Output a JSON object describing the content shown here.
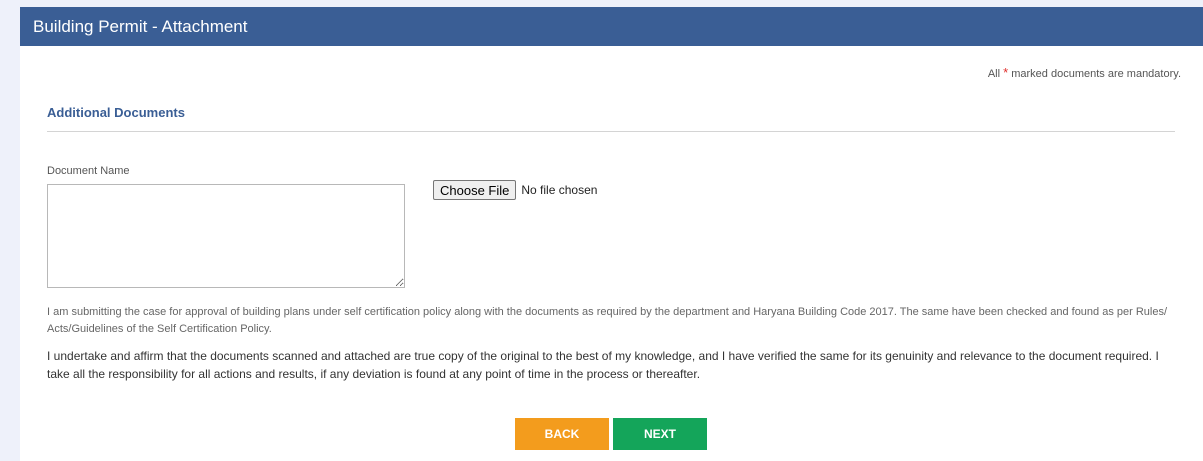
{
  "panel": {
    "title": "Building Permit - Attachment"
  },
  "mandatory_note": {
    "prefix": "All",
    "star": "*",
    "suffix": "marked documents are mandatory."
  },
  "section": {
    "title": "Additional Documents"
  },
  "document": {
    "label": "Document Name",
    "value": "",
    "choose_file_label": "Choose File",
    "file_status": "No file chosen"
  },
  "declarations": [
    "I am submitting the case for approval of building plans under self certification policy along with the documents as required by the department and Haryana Building Code 2017. The same have been checked and found as per Rules/ Acts/Guidelines of the Self Certification Policy.",
    "I undertake and affirm that the documents scanned and attached are true copy of the original to the best of my knowledge, and I have verified the same for its genuinity and relevance to the document required. I take all the responsibility for all actions and results, if any deviation is found at any point of time in the process or thereafter."
  ],
  "buttons": {
    "back": "BACK",
    "next": "NEXT"
  },
  "colors": {
    "header": "#3a5e95",
    "back": "#f39c1d",
    "next": "#14a55a",
    "required_star": "#e0302d"
  }
}
